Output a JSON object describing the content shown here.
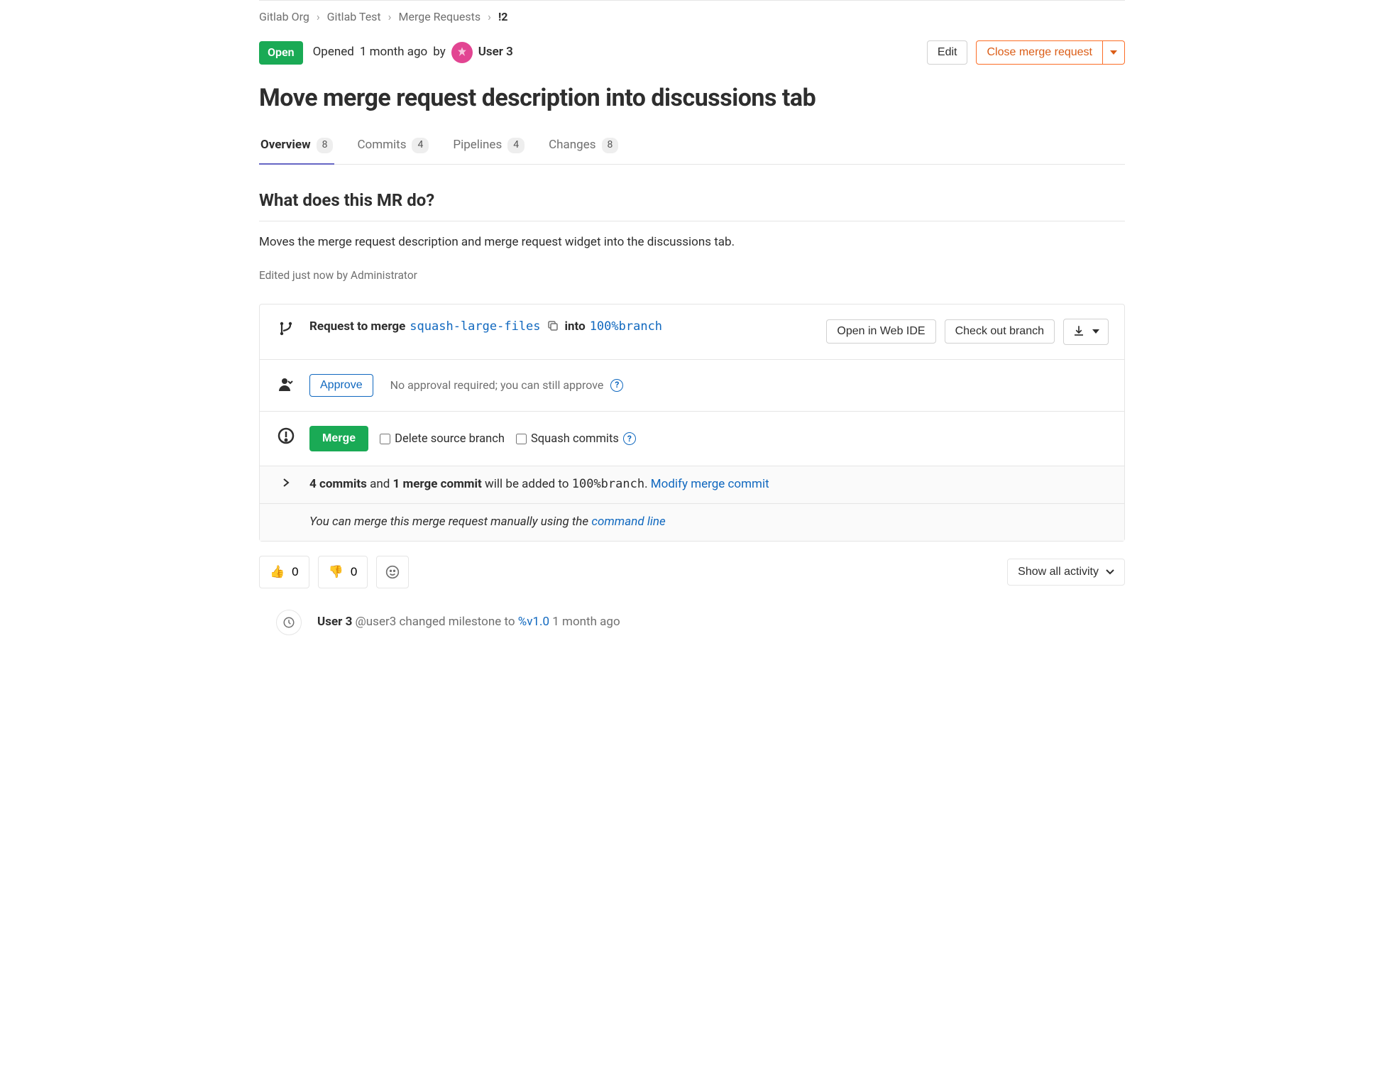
{
  "breadcrumb": {
    "items": [
      "Gitlab Org",
      "Gitlab Test",
      "Merge Requests",
      "!2"
    ]
  },
  "header": {
    "status_badge": "Open",
    "opened_prefix": "Opened",
    "opened_time": "1 month ago",
    "opened_by": "by",
    "author": "User 3",
    "edit_label": "Edit",
    "close_label": "Close merge request"
  },
  "title": "Move merge request description into discussions tab",
  "tabs": [
    {
      "label": "Overview",
      "count": "8",
      "active": true
    },
    {
      "label": "Commits",
      "count": "4",
      "active": false
    },
    {
      "label": "Pipelines",
      "count": "4",
      "active": false
    },
    {
      "label": "Changes",
      "count": "8",
      "active": false
    }
  ],
  "description": {
    "heading": "What does this MR do?",
    "body": "Moves the merge request description and merge request widget into the discussions tab.",
    "edited": "Edited just now by Administrator"
  },
  "merge_widget": {
    "request_label": "Request to merge",
    "source_branch": "squash-large-files",
    "into_label": "into",
    "target_branch": "100%branch",
    "open_ide_label": "Open in Web IDE",
    "checkout_label": "Check out branch",
    "approve_label": "Approve",
    "approval_note": "No approval required; you can still approve",
    "merge_label": "Merge",
    "delete_branch_label": "Delete source branch",
    "squash_label": "Squash commits",
    "commits_summary": {
      "count": "4 commits",
      "and": "and",
      "merge_commit": "1 merge commit",
      "added_to": "will be added to",
      "target_branch": "100%branch",
      "dot": ".",
      "modify_link": "Modify merge commit"
    },
    "manual_merge": {
      "prefix": "You can merge this merge request manually using the",
      "link": "command line"
    }
  },
  "reactions": {
    "thumbs_up": {
      "emoji": "👍",
      "count": "0"
    },
    "thumbs_down": {
      "emoji": "👎",
      "count": "0"
    },
    "filter_label": "Show all activity"
  },
  "activity": {
    "system_note": {
      "author": "User 3",
      "handle": "@user3",
      "action": "changed milestone to",
      "milestone": "%v1.0",
      "time": "1 month ago"
    }
  }
}
